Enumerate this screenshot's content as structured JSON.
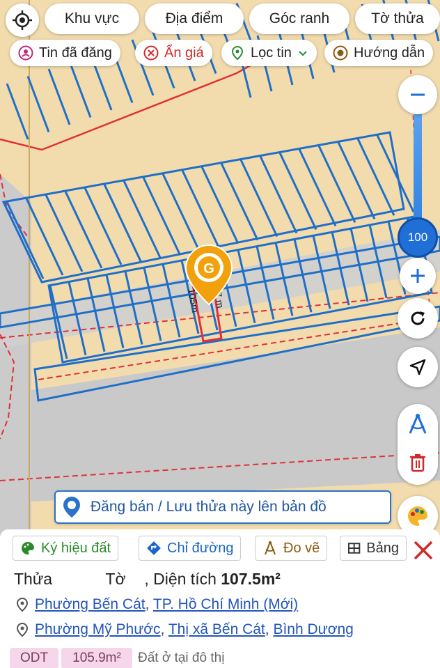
{
  "top_bar": {
    "chips": [
      "Khu vực",
      "Địa điểm",
      "Góc ranh",
      "Tờ thửa"
    ],
    "second_row": [
      {
        "label": "Tin đã đăng",
        "icon": "user-pin-icon",
        "color": "#c2257a"
      },
      {
        "label": "Ẩn giá",
        "icon": "close-circle-icon",
        "color": "#d02929"
      },
      {
        "label": "Lọc tin",
        "icon": "location-pin-icon",
        "color": "#2a8a2a"
      },
      {
        "label": "Hướng dẫn",
        "icon": "play-circle-icon",
        "color": "#8a5a10"
      }
    ]
  },
  "map": {
    "parcel_label_1": "105m",
    "parcel_label_2": "7 m",
    "marker_letter": "G"
  },
  "zoom": {
    "level": "100",
    "track_fill": 1.0
  },
  "save_banner": {
    "label": "Đăng bán / Lưu thửa này lên bản đồ"
  },
  "bottom_tabs": [
    {
      "label": "Ký hiệu đất",
      "icon": "palette-icon",
      "color": "#2a8a2a"
    },
    {
      "label": "Chỉ đường",
      "icon": "direction-icon",
      "color": "#1a66c6"
    },
    {
      "label": "Đo vẽ",
      "icon": "compass-icon",
      "color": "#8a5a10"
    },
    {
      "label": "Bảng",
      "icon": "table-icon",
      "color": "#333"
    }
  ],
  "parcel_info": {
    "thua_label": "Thửa",
    "to_label": "Tờ",
    "area_prefix": ", Diện tích",
    "area_value": "107.5m²",
    "location_new": [
      "Phường Bến Cát",
      "TP. Hồ Chí Minh (Mới)"
    ],
    "location_old": [
      "Phường Mỹ Phước",
      "Thị xã Bến Cát",
      "Bình Dương"
    ],
    "tags": [
      {
        "code": "ODT"
      },
      {
        "code": "105.9m²"
      }
    ],
    "land_desc": "Đất ở tại đô thị"
  },
  "colors": {
    "map_bg": "#f2dcae",
    "parcel_line": "#1f6fc9",
    "boundary_red": "#e0303a",
    "road_gray": "#c8c8c8",
    "accent_blue": "#2a73c9",
    "marker_orange": "#f2a10c"
  }
}
